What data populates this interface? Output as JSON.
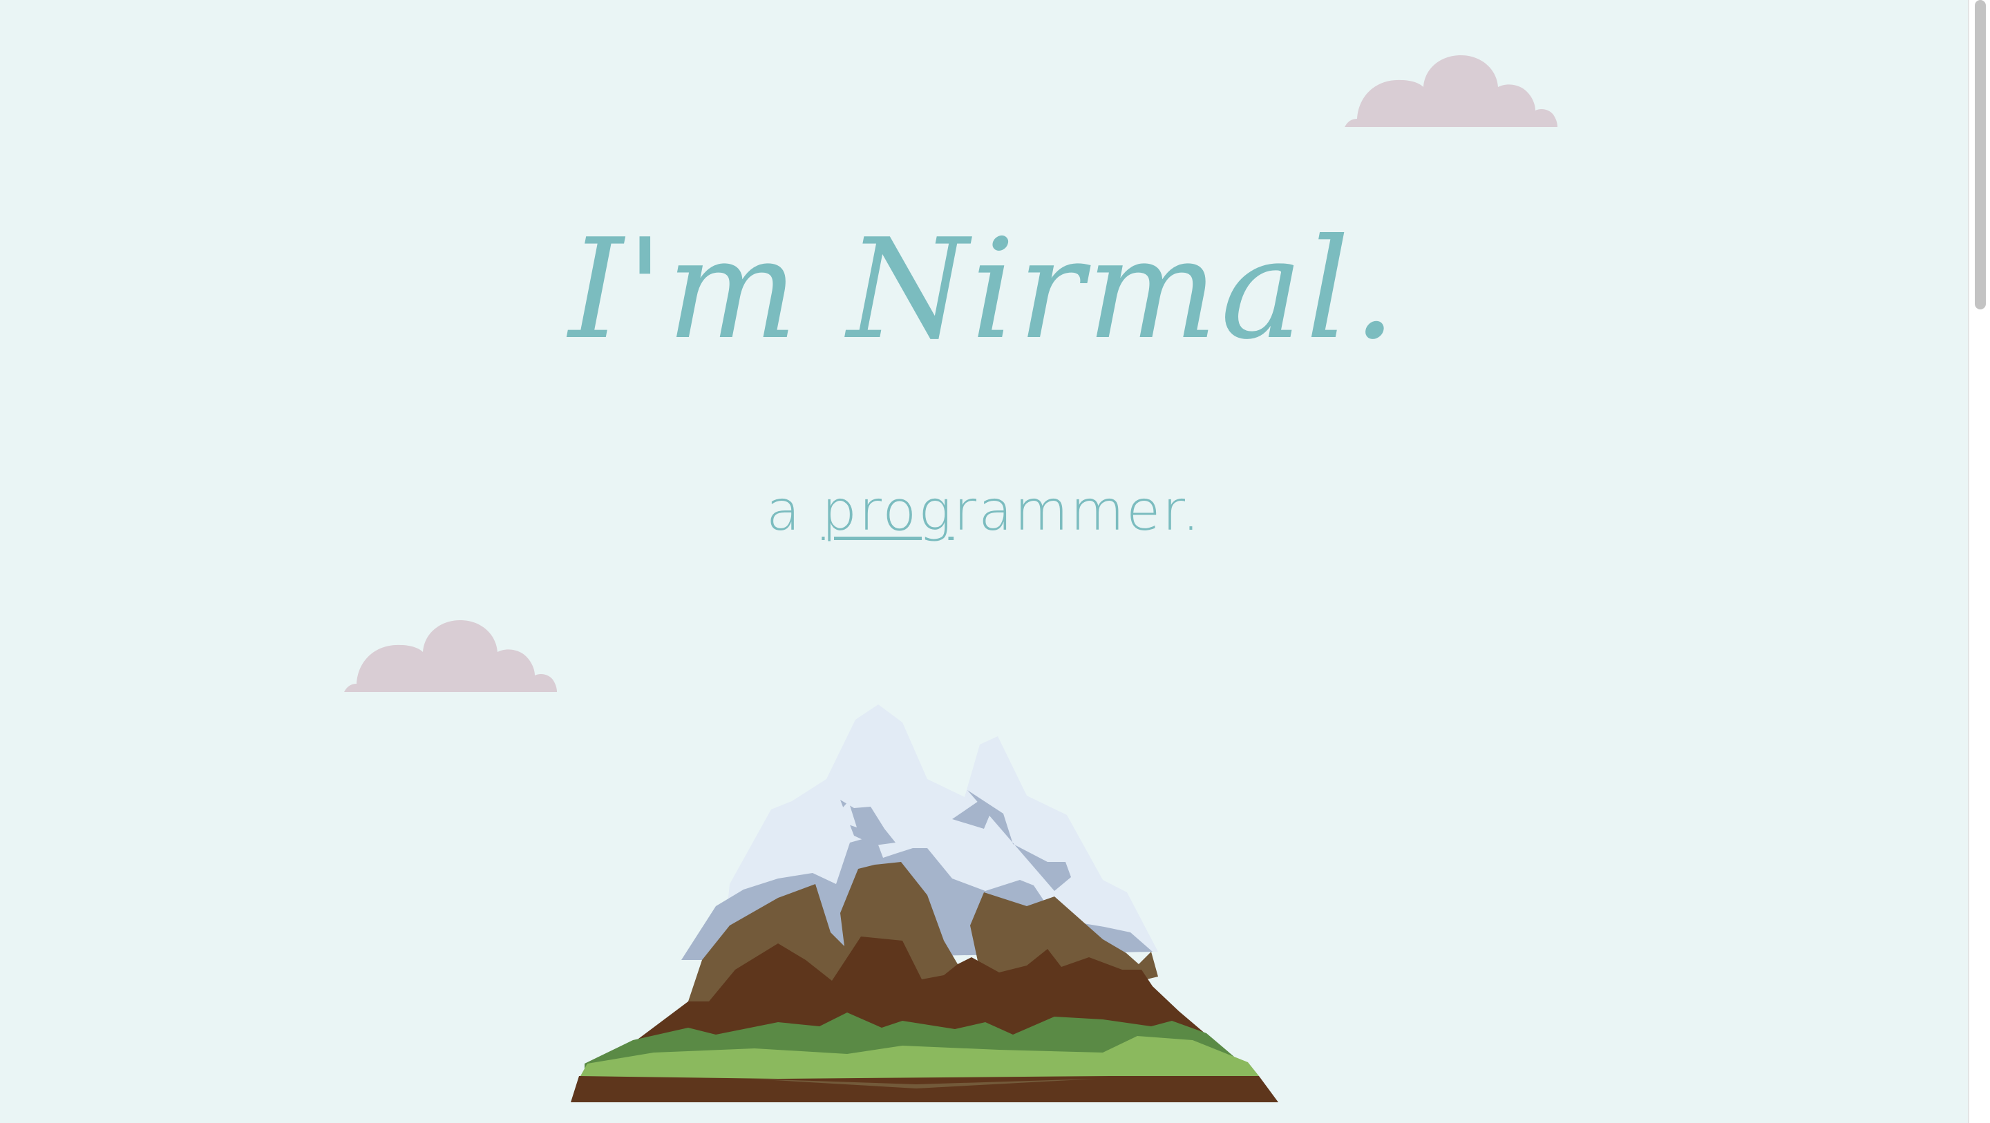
{
  "hero": {
    "greeting": "I'm Nirmal.",
    "tagline_prefix": "a ",
    "tagline_typed": "prog",
    "tagline_rest": "rammer."
  },
  "colors": {
    "background": "#eaf5f5",
    "accent": "#7bbcbf",
    "cloud": "#d9cdd4",
    "snow": "#e2ebf5",
    "snow_shadow": "#a5b4cb",
    "rock_light": "#735a3a",
    "rock_dark": "#5e361c",
    "grass_dark": "#5a8a45",
    "grass_light": "#8bb95e"
  },
  "icons": {
    "cloud_top": "cloud-icon",
    "cloud_left": "cloud-icon",
    "mountain": "mountain-illustration"
  }
}
